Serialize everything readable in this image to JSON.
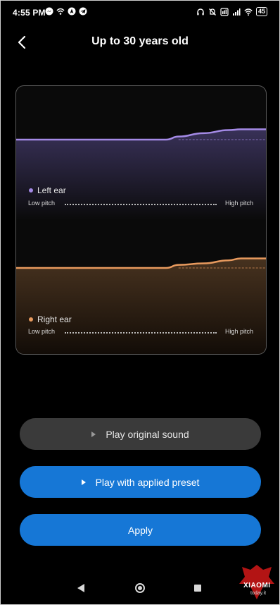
{
  "status_bar": {
    "time": "4:55 PM",
    "left_icons": [
      "messenger-icon",
      "wifi-calling-icon",
      "navigation-icon",
      "telegram-icon"
    ],
    "right_icons": [
      "headphones-icon",
      "mute-icon",
      "sim-icon",
      "signal-icon",
      "wifi-icon"
    ],
    "battery": "45"
  },
  "header": {
    "back_icon": "chevron-left-icon",
    "title": "Up to 30 years old"
  },
  "chart": {
    "left": {
      "label": "Left ear",
      "color": "#a48ae6",
      "low": "Low pitch",
      "high": "High pitch"
    },
    "right": {
      "label": "Right ear",
      "color": "#e89a5e",
      "low": "Low pitch",
      "high": "High pitch"
    }
  },
  "chart_data": [
    {
      "type": "line",
      "x": [
        0,
        0.25,
        0.5,
        0.6,
        0.65,
        0.75,
        0.85,
        0.9,
        1.0
      ],
      "series": [
        {
          "name": "Left ear",
          "values": [
            0,
            0,
            0,
            0,
            0.08,
            0.17,
            0.25,
            0.27,
            0.27
          ]
        }
      ],
      "ylim": [
        0,
        1
      ],
      "xlabel_low": "Low pitch",
      "xlabel_high": "High pitch"
    },
    {
      "type": "line",
      "x": [
        0,
        0.25,
        0.5,
        0.6,
        0.65,
        0.75,
        0.85,
        0.9,
        1.0
      ],
      "series": [
        {
          "name": "Right ear",
          "values": [
            0,
            0,
            0,
            0,
            0.08,
            0.12,
            0.2,
            0.25,
            0.25
          ]
        }
      ],
      "ylim": [
        0,
        1
      ],
      "xlabel_low": "Low pitch",
      "xlabel_high": "High pitch"
    }
  ],
  "buttons": {
    "play_original": "Play original sound",
    "play_preset": "Play with applied preset",
    "apply": "Apply"
  },
  "nav": {
    "back_icon": "nav-back-icon",
    "home_icon": "nav-home-icon",
    "recents_icon": "nav-recents-icon"
  },
  "watermark": {
    "text": "XIAOMI",
    "sub": "today.it"
  }
}
